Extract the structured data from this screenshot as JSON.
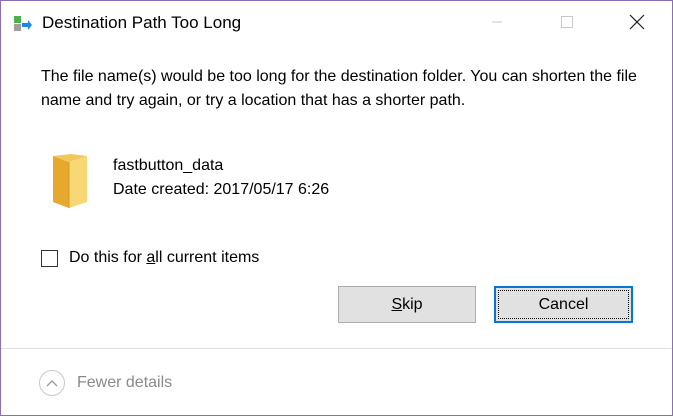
{
  "window": {
    "title": "Destination Path Too Long",
    "app_icon": "move-files-icon",
    "controls": {
      "minimize": "minimize-icon",
      "maximize": "maximize-icon",
      "close": "close-icon"
    }
  },
  "dialog": {
    "message": "The file name(s) would be too long for the destination folder. You can shorten the file name and try again, or try a location that has a shorter path.",
    "item": {
      "icon": "folder-icon",
      "name": "fastbutton_data",
      "date_created": "Date created: 2017/05/17 6:26"
    },
    "checkbox": {
      "label_before": "Do this for ",
      "label_accel": "a",
      "label_after": "ll current items",
      "checked": false
    },
    "buttons": {
      "skip_accel": "S",
      "skip_rest": "kip",
      "cancel": "Cancel"
    },
    "details_toggle": {
      "label": "Fewer details",
      "icon": "chevron-up-icon"
    }
  },
  "colors": {
    "window_border": "#8a6fb5",
    "focus_border": "#0078d7",
    "button_face": "#e1e1e1",
    "muted_text": "#8a8a8a",
    "folder_yellow": "#f2c75c"
  }
}
